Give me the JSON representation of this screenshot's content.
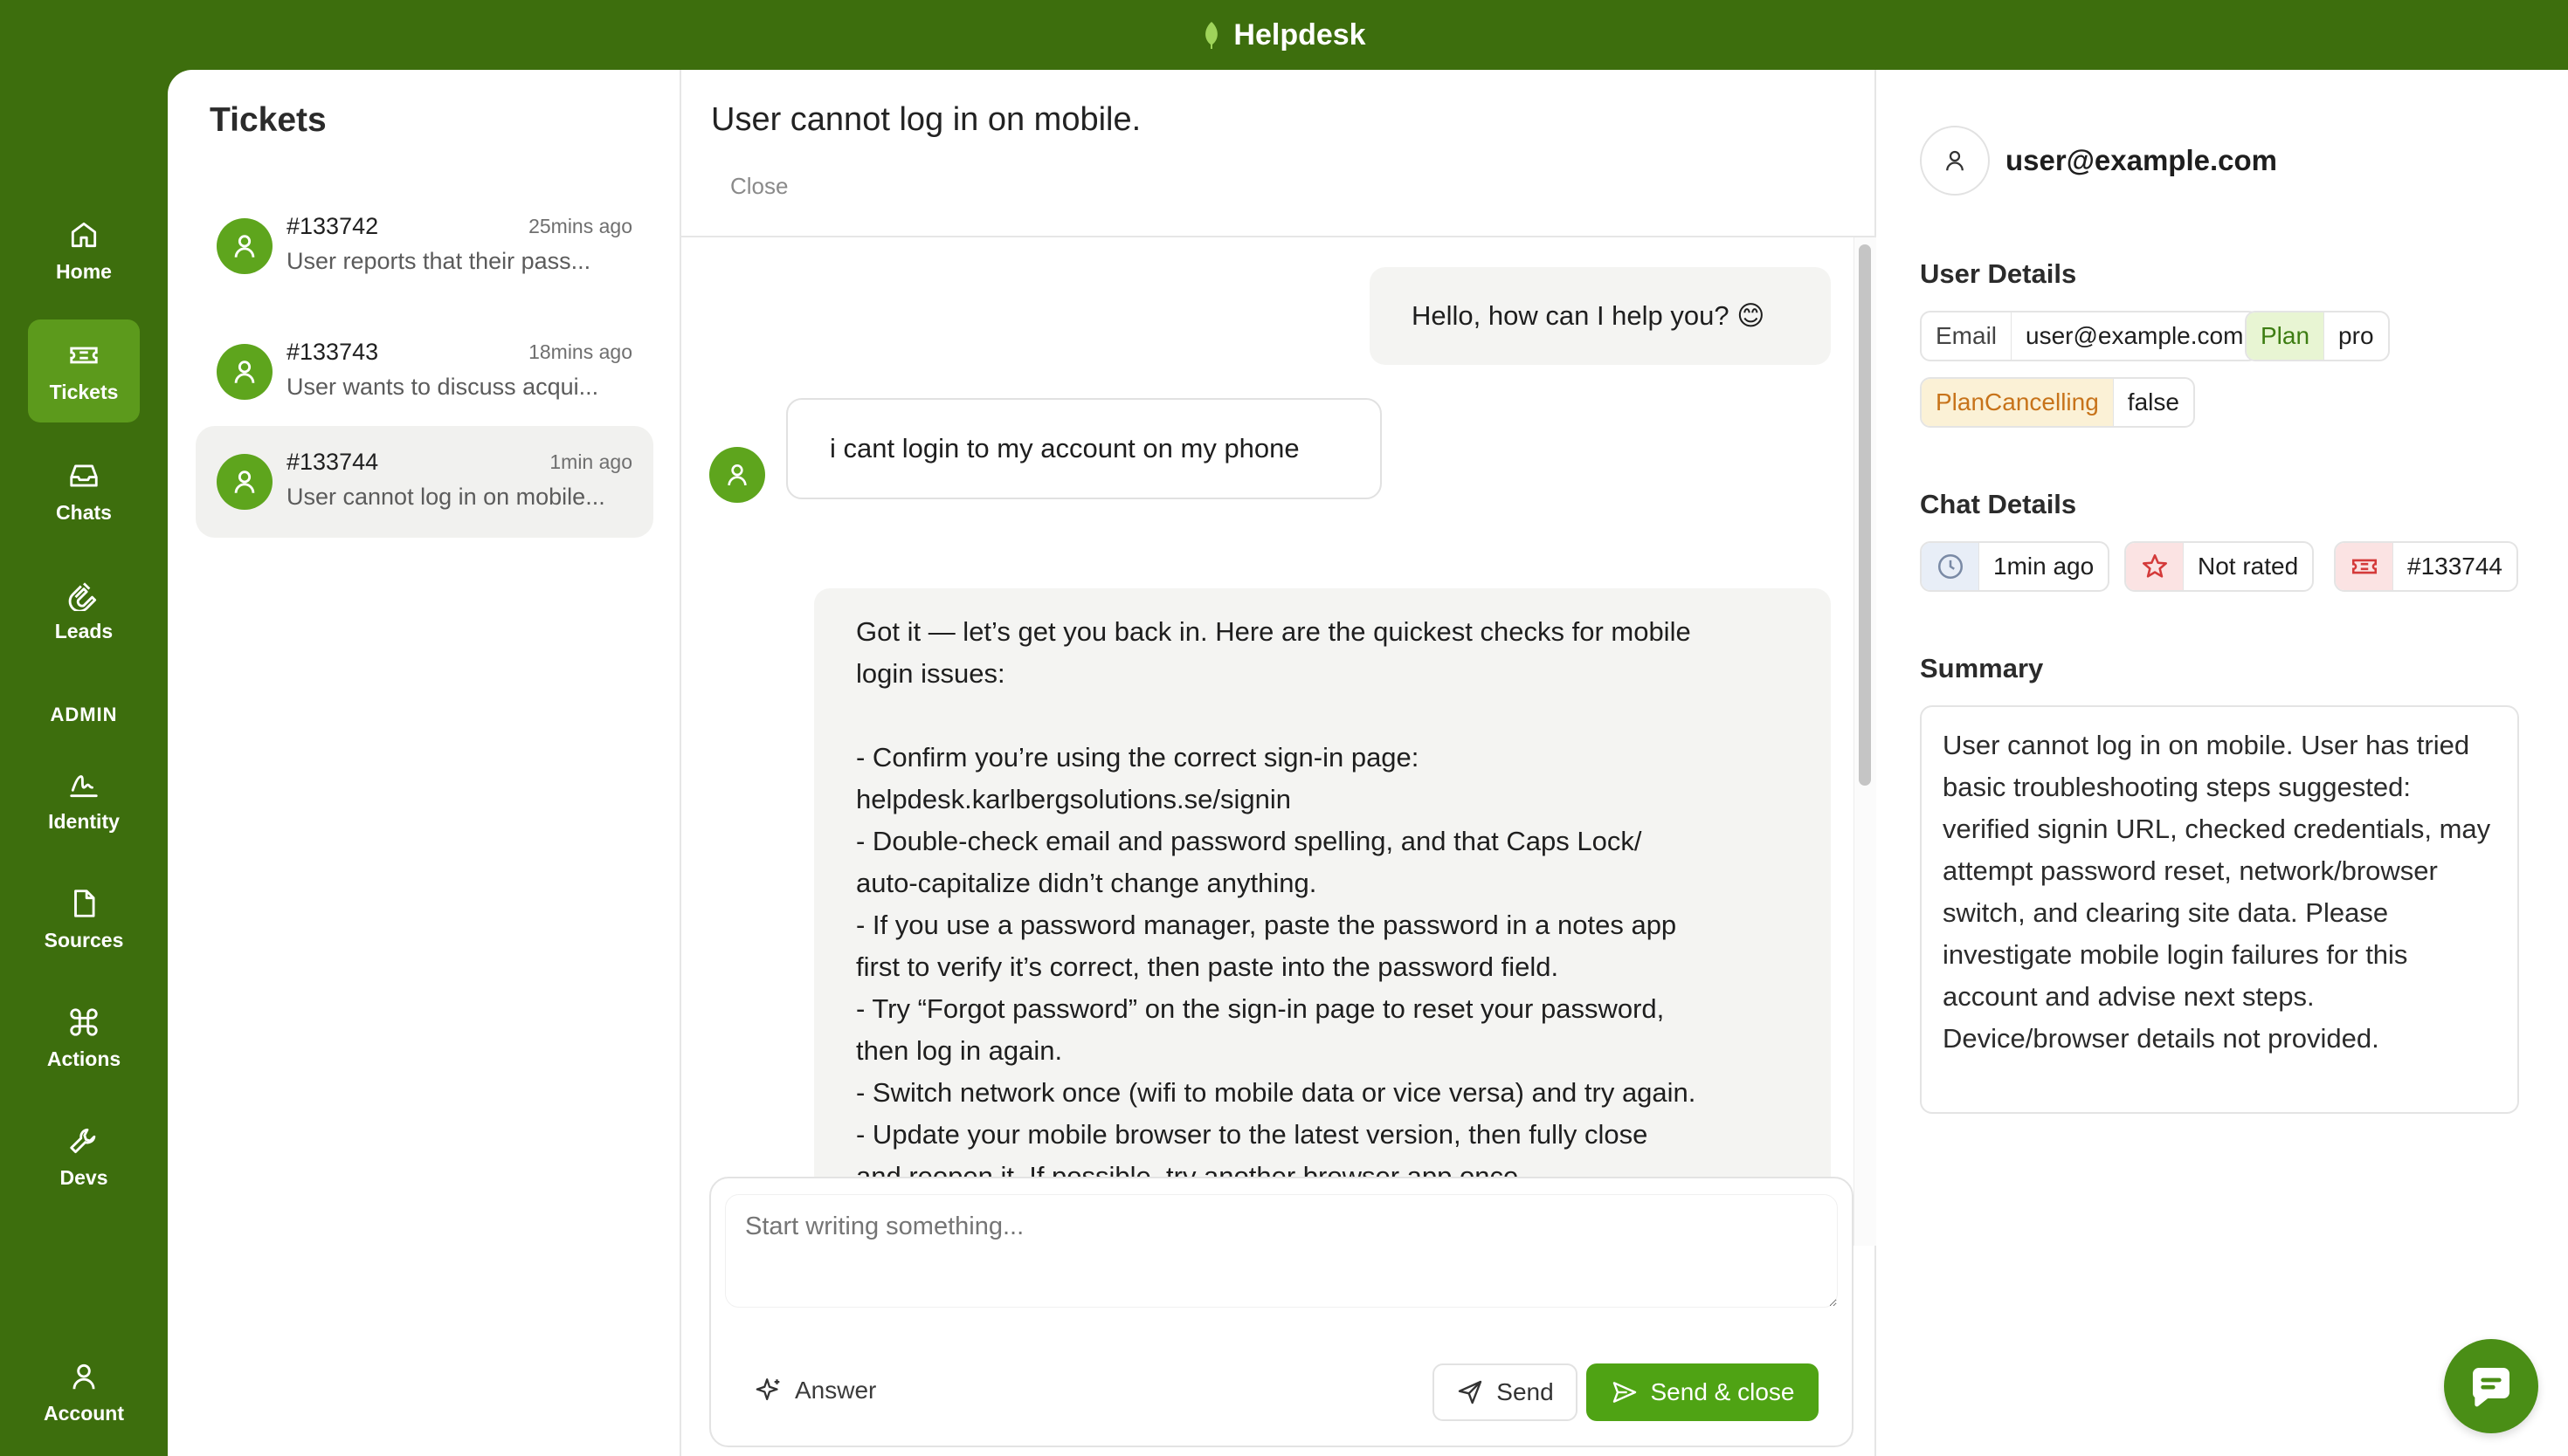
{
  "app": {
    "title": "Helpdesk"
  },
  "sidebar": {
    "items": [
      {
        "label": "Home",
        "icon": "home-icon"
      },
      {
        "label": "Tickets",
        "icon": "ticket-icon",
        "active": true
      },
      {
        "label": "Chats",
        "icon": "inbox-icon"
      },
      {
        "label": "Leads",
        "icon": "magnet-icon"
      }
    ],
    "admin_label": "ADMIN",
    "admin_items": [
      {
        "label": "Identity",
        "icon": "signature-icon"
      },
      {
        "label": "Sources",
        "icon": "file-icon"
      },
      {
        "label": "Actions",
        "icon": "command-icon"
      },
      {
        "label": "Devs",
        "icon": "wrench-icon"
      }
    ],
    "account_label": "Account"
  },
  "tickets": {
    "title": "Tickets",
    "list": [
      {
        "id": "#133742",
        "time": "25mins ago",
        "preview": "User reports that their pass..."
      },
      {
        "id": "#133743",
        "time": "18mins ago",
        "preview": "User wants to discuss acqui..."
      },
      {
        "id": "#133744",
        "time": "1min ago",
        "preview": "User cannot log in on mobile...",
        "active": true
      }
    ]
  },
  "chat": {
    "title": "User cannot log in on mobile.",
    "close_label": "Close",
    "messages": [
      {
        "from": "agent",
        "text": "Hello, how can I help you? 😊"
      },
      {
        "from": "user",
        "text": "i cant login to my account on my phone"
      },
      {
        "from": "agent",
        "text": "Got it — let’s get you back in. Here are the quickest checks for mobile\nlogin issues:\n\n- Confirm you’re using the correct sign-in page:\nhelpdesk.karlbergsolutions.se/signin\n- Double-check email and password spelling, and that Caps Lock/\nauto-capitalize didn’t change anything.\n- If you use a password manager, paste the password in a notes app\nfirst to verify it’s correct, then paste into the password field.\n- Try “Forgot password” on the sign-in page to reset your password,\nthen log in again.\n- Switch network once (wifi to mobile data or vice versa) and try again.\n- Update your mobile browser to the latest version, then fully close\nand reopen it. If possible, try another browser app once.\n- Clear only the site data for helpdesk.karlbergsolutions.se in your"
      }
    ],
    "composer": {
      "placeholder": "Start writing something...",
      "answer_label": "Answer",
      "send_label": "Send",
      "send_close_label": "Send & close"
    }
  },
  "details": {
    "user_email": "user@example.com",
    "user_details_title": "User Details",
    "user_tags": [
      {
        "key": "Email",
        "value": "user@example.com"
      },
      {
        "key": "Plan",
        "value": "pro"
      },
      {
        "key": "PlanCancelling",
        "value": "false"
      }
    ],
    "chat_details_title": "Chat Details",
    "chat_tags": [
      {
        "icon": "clock-icon",
        "value": "1min ago"
      },
      {
        "icon": "star-icon",
        "value": "Not rated"
      },
      {
        "icon": "ticket-icon",
        "value": "#133744"
      }
    ],
    "summary_title": "Summary",
    "summary_text": "User cannot log in on mobile. User has tried basic troubleshooting steps suggested: verified signin URL, checked credentials, may attempt password reset, network/browser switch, and clearing site data. Please investigate mobile login failures for this account and advise next steps. Device/browser details not provided."
  },
  "colors": {
    "brand": "#3d6e0d",
    "accent": "#4fa314",
    "avatar": "#5ea51d"
  }
}
